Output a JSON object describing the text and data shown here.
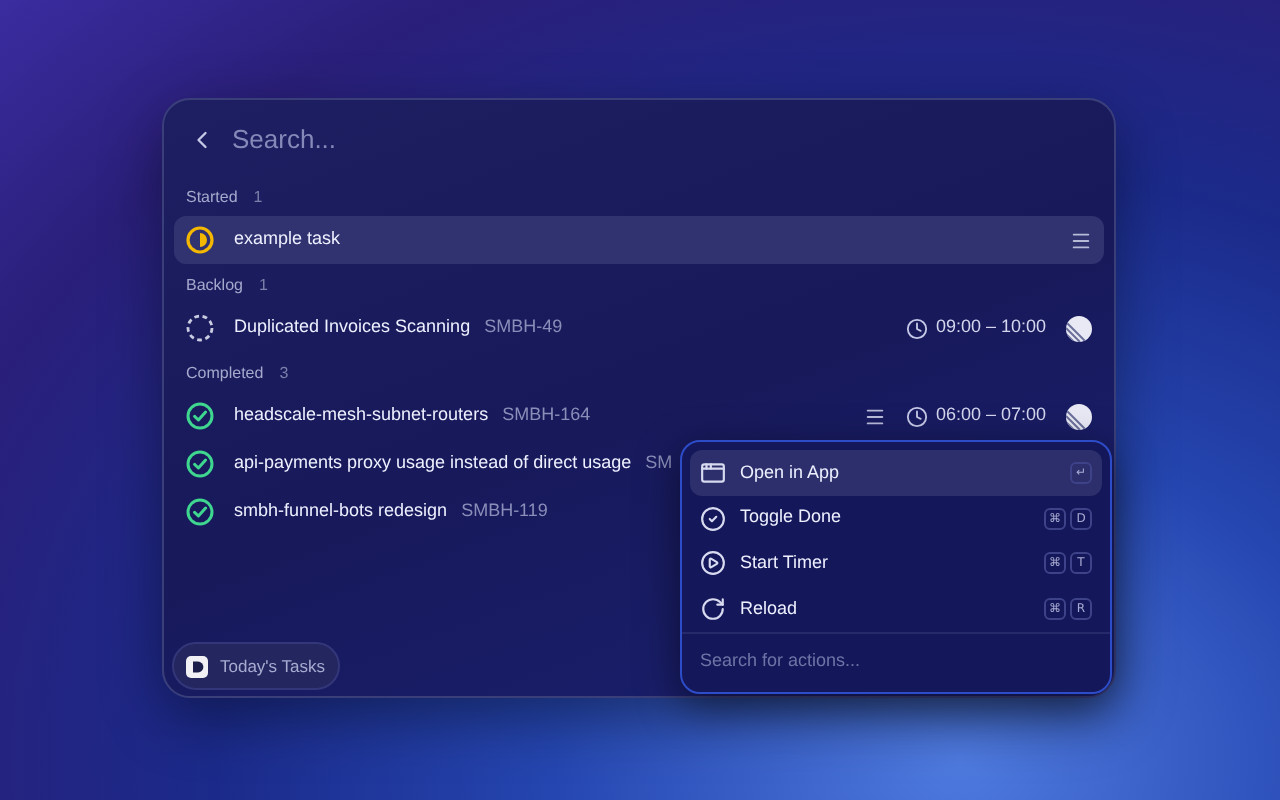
{
  "search": {
    "placeholder": "Search..."
  },
  "sections": [
    {
      "title": "Started",
      "count": "1",
      "tasks": [
        {
          "kind": "started",
          "title": "example task",
          "selected": true,
          "menu": true
        }
      ]
    },
    {
      "title": "Backlog",
      "count": "1",
      "tasks": [
        {
          "kind": "backlog",
          "title": "Duplicated Invoices Scanning",
          "id": "SMBH-49",
          "time": "09:00 – 10:00",
          "selected": false,
          "menu": false
        }
      ]
    },
    {
      "title": "Completed",
      "count": "3",
      "tasks": [
        {
          "kind": "completed",
          "title": "headscale-mesh-subnet-routers",
          "id": "SMBH-164",
          "time": "06:00 – 07:00",
          "selected": false,
          "menu": true
        },
        {
          "kind": "completed",
          "title": "api-payments proxy usage instead of direct usage",
          "id": "SM",
          "selected": false,
          "menu": false
        },
        {
          "kind": "completed",
          "title": "smbh-funnel-bots redesign",
          "id": "SMBH-119",
          "selected": false,
          "menu": false
        }
      ]
    }
  ],
  "footer_button": "Today's Tasks",
  "actions_menu": {
    "items": [
      {
        "kind": "open",
        "label": "Open in App",
        "keys": [
          "↵"
        ],
        "selected": true
      },
      {
        "kind": "toggle",
        "label": "Toggle Done",
        "keys": [
          "⌘",
          "D"
        ],
        "selected": false
      },
      {
        "kind": "timer",
        "label": "Start Timer",
        "keys": [
          "⌘",
          "T"
        ],
        "selected": false
      },
      {
        "kind": "reload",
        "label": "Reload",
        "keys": [
          "⌘",
          "R"
        ],
        "selected": false
      }
    ],
    "search_placeholder": "Search for actions..."
  }
}
